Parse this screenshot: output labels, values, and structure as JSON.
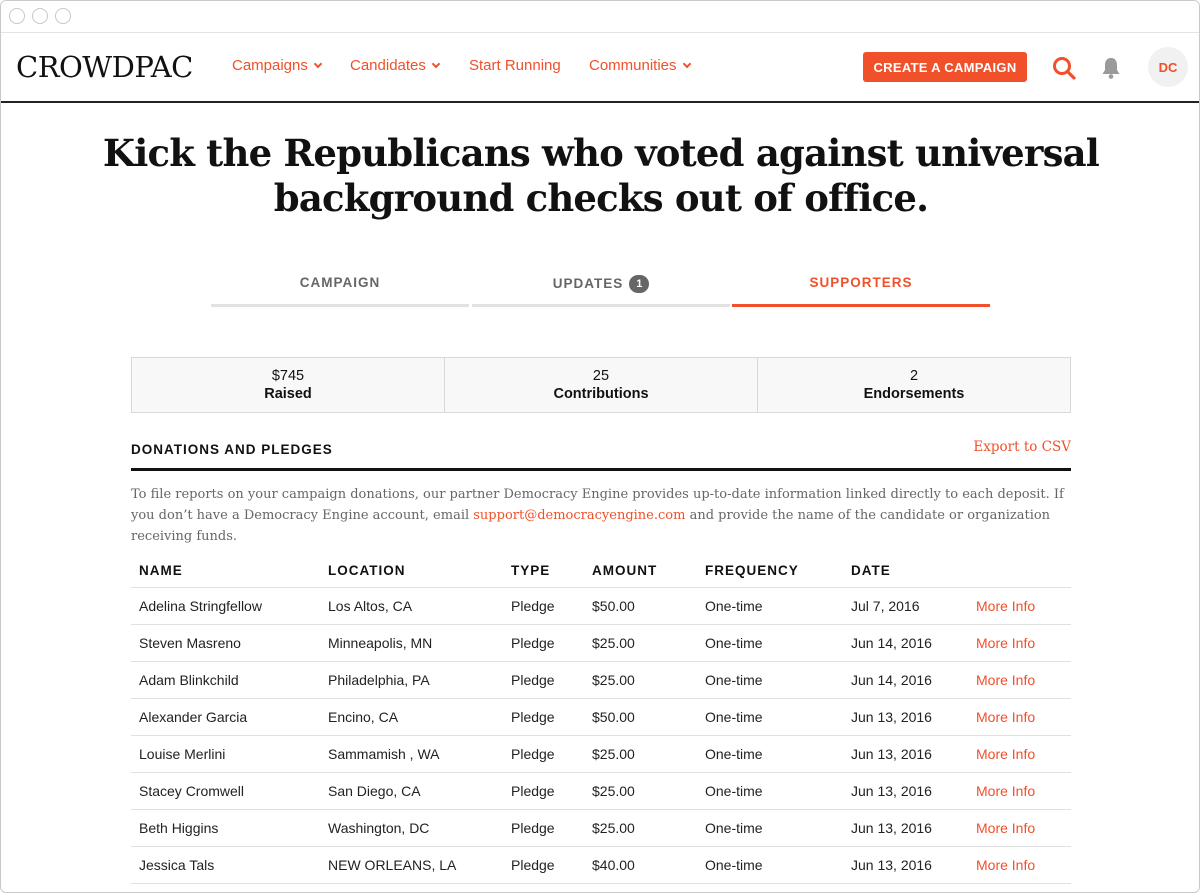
{
  "brand": {
    "logo": "CROWDPAC",
    "accent": "#f0502a"
  },
  "nav": {
    "items": [
      {
        "label": "Campaigns",
        "dropdown": true
      },
      {
        "label": "Candidates",
        "dropdown": true
      },
      {
        "label": "Start Running",
        "dropdown": false
      },
      {
        "label": "Communities",
        "dropdown": true
      }
    ],
    "cta_label": "CREATE A CAMPAIGN",
    "avatar_initials": "DC"
  },
  "page": {
    "title_line1": "Kick the Republicans who voted against universal",
    "title_line2": "background checks out of office."
  },
  "tabs": [
    {
      "label": "CAMPAIGN",
      "active": false
    },
    {
      "label": "UPDATES",
      "badge": "1",
      "active": false
    },
    {
      "label": "SUPPORTERS",
      "active": true
    }
  ],
  "stats": [
    {
      "value": "$745",
      "label": "Raised"
    },
    {
      "value": "25",
      "label": "Contributions"
    },
    {
      "value": "2",
      "label": "Endorsements"
    }
  ],
  "donations": {
    "title": "DONATIONS AND PLEDGES",
    "export_label": "Export to CSV",
    "intro_before": "To file reports on your campaign donations, our partner Democracy Engine provides up-to-date information linked directly to each deposit. If you don’t have a Democracy Engine account, email ",
    "intro_email": "support@democracyengine.com",
    "intro_after": " and provide the name of the candidate or organization receiving funds.",
    "columns": [
      "NAME",
      "LOCATION",
      "TYPE",
      "AMOUNT",
      "FREQUENCY",
      "DATE"
    ],
    "rows": [
      {
        "name": "Adelina Stringfellow",
        "location": "Los Altos, CA",
        "type": "Pledge",
        "amount": "$50.00",
        "frequency": "One-time",
        "date": "Jul 7, 2016",
        "action": "More Info"
      },
      {
        "name": "Steven Masreno",
        "location": "Minneapolis, MN",
        "type": "Pledge",
        "amount": "$25.00",
        "frequency": "One-time",
        "date": "Jun 14, 2016",
        "action": "More Info"
      },
      {
        "name": "Adam Blinkchild",
        "location": "Philadelphia, PA",
        "type": "Pledge",
        "amount": "$25.00",
        "frequency": "One-time",
        "date": "Jun 14, 2016",
        "action": "More Info"
      },
      {
        "name": "Alexander Garcia",
        "location": "Encino, CA",
        "type": "Pledge",
        "amount": "$50.00",
        "frequency": "One-time",
        "date": "Jun 13, 2016",
        "action": "More Info"
      },
      {
        "name": "Louise Merlini",
        "location": "Sammamish , WA",
        "type": "Pledge",
        "amount": "$25.00",
        "frequency": "One-time",
        "date": "Jun 13, 2016",
        "action": "More Info"
      },
      {
        "name": "Stacey Cromwell",
        "location": "San Diego, CA",
        "type": "Pledge",
        "amount": "$25.00",
        "frequency": "One-time",
        "date": "Jun 13, 2016",
        "action": "More Info"
      },
      {
        "name": "Beth Higgins",
        "location": "Washington, DC",
        "type": "Pledge",
        "amount": "$25.00",
        "frequency": "One-time",
        "date": "Jun 13, 2016",
        "action": "More Info"
      },
      {
        "name": "Jessica Tals",
        "location": "NEW ORLEANS, LA",
        "type": "Pledge",
        "amount": "$40.00",
        "frequency": "One-time",
        "date": "Jun 13, 2016",
        "action": "More Info"
      }
    ]
  }
}
